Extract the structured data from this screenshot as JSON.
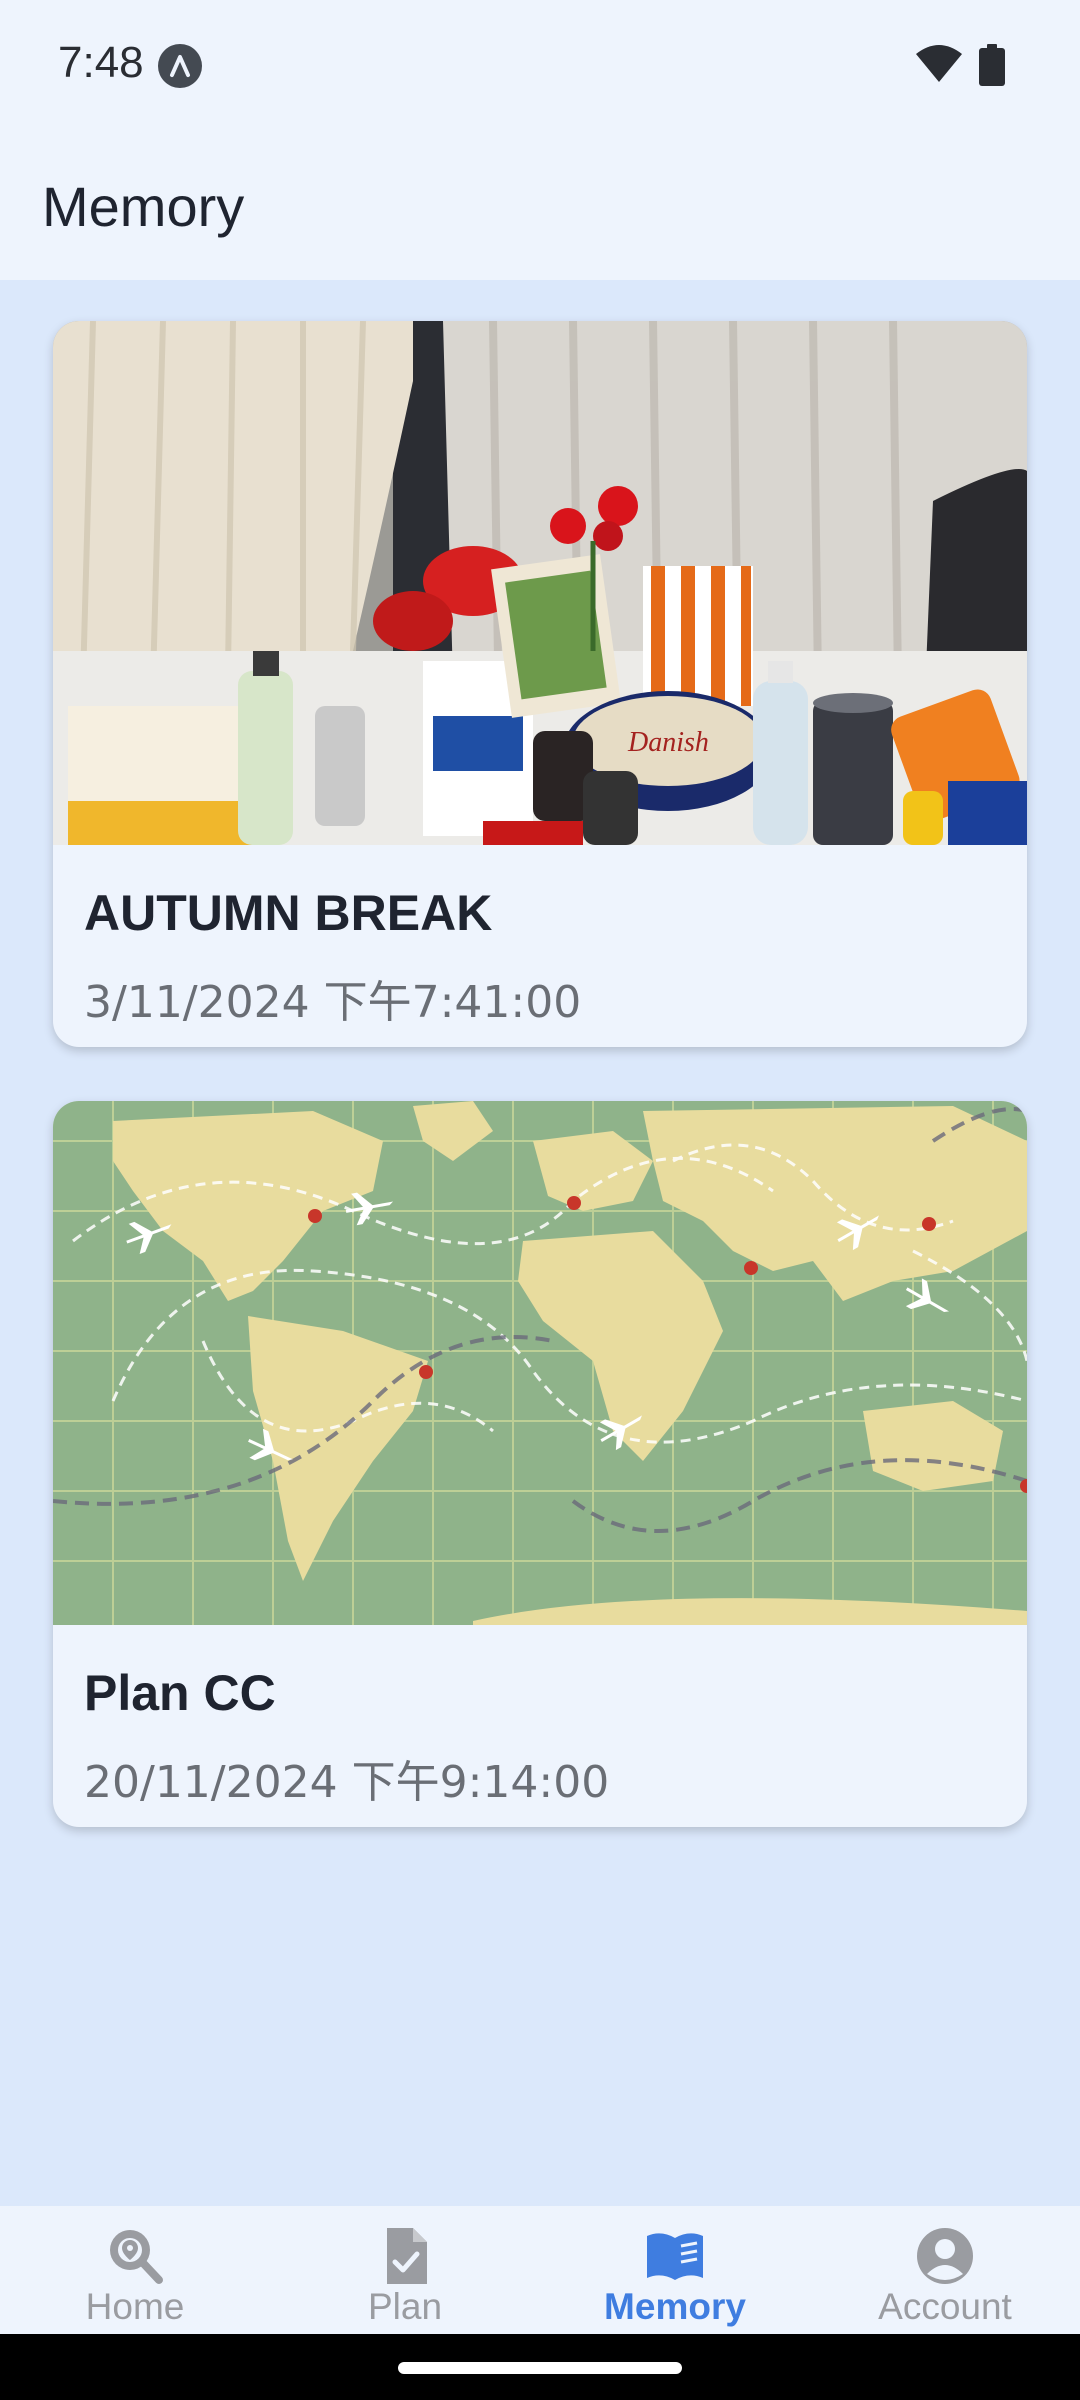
{
  "status_bar": {
    "time": "7:48",
    "icons": [
      "a-badge-icon",
      "wifi-icon",
      "battery-icon"
    ]
  },
  "app_bar": {
    "title": "Memory"
  },
  "memories": [
    {
      "title": "AUTUMN BREAK",
      "date": "3/11/2024 下午7:41:00",
      "image": "photo of a table with snacks, drinks and flowers by a curtain"
    },
    {
      "title": "Plan CC",
      "date": "20/11/2024 下午9:14:00",
      "image": "vintage world map with airplanes and dashed flight routes"
    }
  ],
  "bottom_nav": {
    "items": [
      {
        "label": "Home",
        "icon": "search-location-icon",
        "active": false
      },
      {
        "label": "Plan",
        "icon": "document-check-icon",
        "active": false
      },
      {
        "label": "Memory",
        "icon": "book-icon",
        "active": true
      },
      {
        "label": "Account",
        "icon": "account-circle-icon",
        "active": false
      }
    ]
  },
  "colors": {
    "background": "#dbe8fb",
    "surface": "#eef4fd",
    "accent": "#3f7de0",
    "inactive": "#9a9ca1"
  }
}
